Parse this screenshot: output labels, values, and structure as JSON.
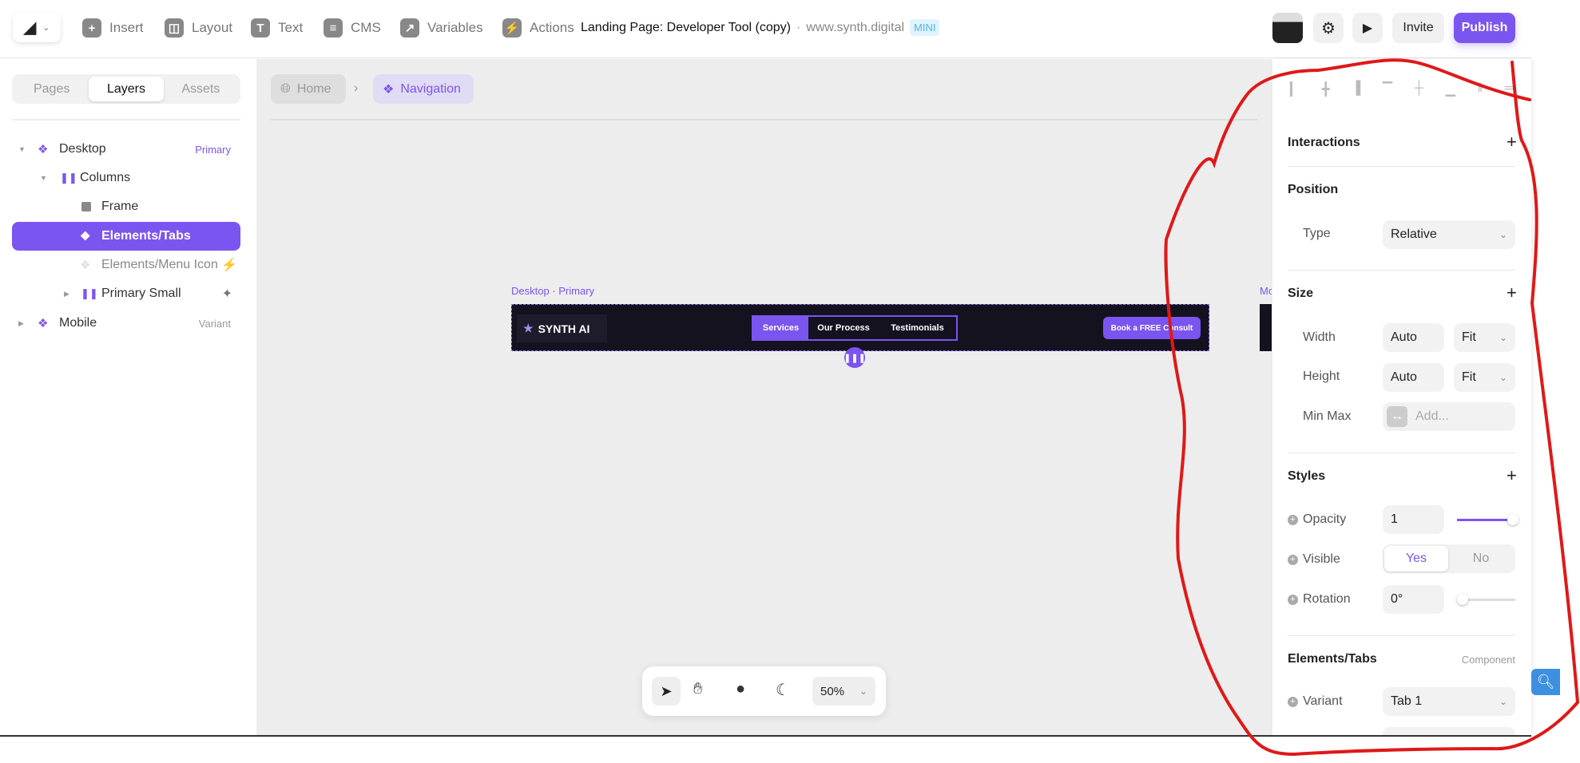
{
  "toolbar": {
    "items": [
      {
        "label": "Insert",
        "icon": "plus-icon"
      },
      {
        "label": "Layout",
        "icon": "layout-icon"
      },
      {
        "label": "Text",
        "icon": "text-icon"
      },
      {
        "label": "CMS",
        "icon": "database-icon"
      },
      {
        "label": "Variables",
        "icon": "arrow-icon"
      },
      {
        "label": "Actions",
        "icon": "bolt-icon"
      }
    ],
    "project_title": "Landing Page: Developer Tool (copy)",
    "separator": "·",
    "domain": "www.synth.digital",
    "plan_badge": "MINI",
    "invite": "Invite",
    "publish": "Publish"
  },
  "left_panel": {
    "tabs": [
      "Pages",
      "Layers",
      "Assets"
    ],
    "active_tab": "Layers",
    "layers": [
      {
        "label": "Desktop",
        "tag": "Primary",
        "icon": "component-icon"
      },
      {
        "label": "Columns",
        "icon": "columns-icon"
      },
      {
        "label": "Frame",
        "icon": "frame-icon"
      },
      {
        "label": "Elements/Tabs",
        "icon": "component-icon",
        "selected": true
      },
      {
        "label": "Elements/Menu Icon",
        "icon": "component-icon"
      },
      {
        "label": "Primary Small",
        "icon": "columns-icon"
      },
      {
        "label": "Mobile",
        "tag": "Variant",
        "icon": "component-icon"
      }
    ]
  },
  "canvas": {
    "breadcrumb": {
      "home": "Home",
      "current": "Navigation"
    },
    "frame_label": "Desktop · Primary",
    "mobile_label": "Mo",
    "nav": {
      "logo": "SYNTH AI",
      "tabs": [
        "Services",
        "Our Process",
        "Testimonials"
      ],
      "active_tab": "Services",
      "cta": "Book a FREE Consult"
    },
    "zoom": "50%"
  },
  "right_panel": {
    "interactions": "Interactions",
    "position": {
      "title": "Position",
      "type_label": "Type",
      "type_value": "Relative"
    },
    "size": {
      "title": "Size",
      "width_label": "Width",
      "width_value": "Auto",
      "width_mode": "Fit",
      "height_label": "Height",
      "height_value": "Auto",
      "height_mode": "Fit",
      "minmax_label": "Min Max",
      "minmax_placeholder": "Add..."
    },
    "styles": {
      "title": "Styles",
      "opacity_label": "Opacity",
      "opacity_value": "1",
      "opacity_fraction": 1,
      "visible_label": "Visible",
      "yes": "Yes",
      "no": "No",
      "rotation_label": "Rotation",
      "rotation_value": "0°"
    },
    "component": {
      "title": "Elements/Tabs",
      "tag": "Component",
      "variant_label": "Variant",
      "variant_value": "Tab 1"
    }
  },
  "colors": {
    "accent": "#7b55f0",
    "annotation": "#e01818",
    "canvas": "#ededed",
    "nav_bg": "#15121f"
  }
}
